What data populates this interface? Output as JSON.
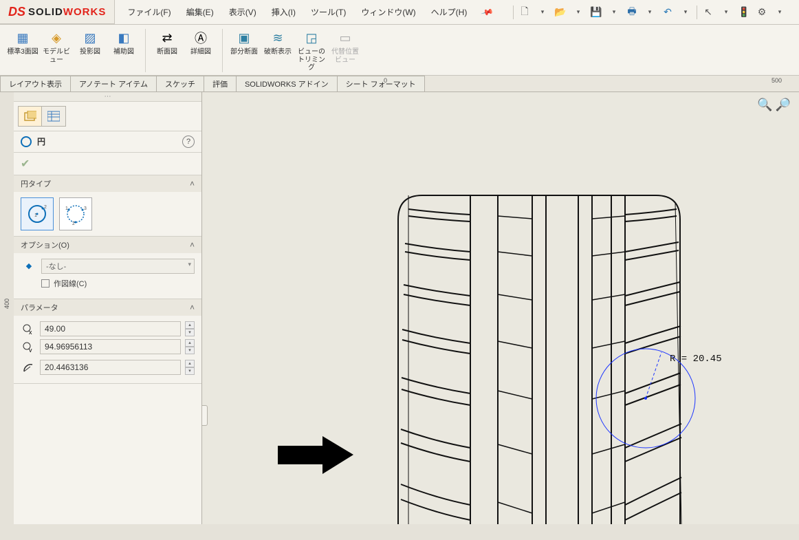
{
  "app": {
    "name_bold": "SOLID",
    "name_red": "WORKS"
  },
  "menu": {
    "file": "ファイル(F)",
    "edit": "編集(E)",
    "view": "表示(V)",
    "insert": "挿入(I)",
    "tools": "ツール(T)",
    "window": "ウィンドウ(W)",
    "help": "ヘルプ(H)"
  },
  "ribbon": {
    "std3view": "標準3面図",
    "modelview": "モデルビュー",
    "projview": "投影図",
    "auxview": "補助図",
    "section": "断面図",
    "detail": "詳細図",
    "broken_section": "部分断面",
    "broken_view": "破断表示",
    "crop": "ビューのトリミング",
    "altpos": "代替位置ビュー"
  },
  "tabs": {
    "layout": "レイアウト表示",
    "anno": "アノテート アイテム",
    "sketch": "スケッチ",
    "eval": "評価",
    "addins": "SOLIDWORKS アドイン",
    "sheet": "シート フォーマット"
  },
  "ruler": {
    "zero": "0",
    "right": "500",
    "left": "400"
  },
  "pm": {
    "title": "円",
    "section_type": "円タイプ",
    "section_options": "オプション(O)",
    "option_none": "-なし-",
    "option_construction": "作図線(C)",
    "section_params": "パラメータ",
    "param_x": "49.00",
    "param_y": "94.96956113",
    "param_r": "20.4463136"
  },
  "viewport": {
    "radius_label": "R = 20.45"
  }
}
